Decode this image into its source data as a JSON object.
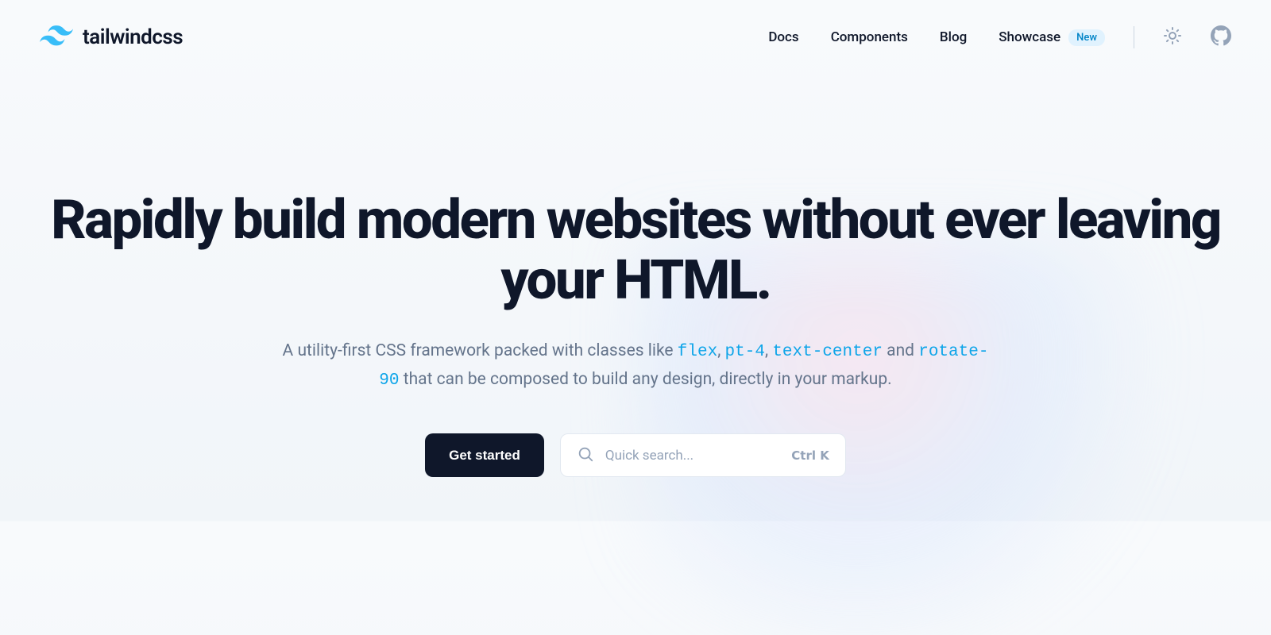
{
  "brand": {
    "name": "tailwindcss",
    "accent": "#38bdf8"
  },
  "nav": {
    "items": [
      {
        "label": "Docs"
      },
      {
        "label": "Components"
      },
      {
        "label": "Blog"
      },
      {
        "label": "Showcase",
        "badge": "New"
      }
    ]
  },
  "hero": {
    "title": "Rapidly build modern websites without ever leaving your HTML.",
    "desc_part1": "A utility-first CSS framework packed with classes like ",
    "class1": "flex",
    "sep1": ", ",
    "class2": "pt-4",
    "sep2": ", ",
    "class3": "text-center",
    "sep3": " and ",
    "class4": "rotate-90",
    "desc_part2": " that can be composed to build any design, directly in your markup."
  },
  "cta": {
    "primary": "Get started",
    "search_placeholder": "Quick search...",
    "kbd_ctrl": "Ctrl ",
    "kbd_key": "K"
  }
}
